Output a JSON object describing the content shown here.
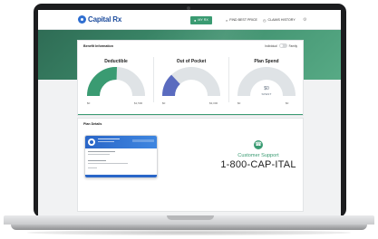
{
  "app": {
    "brand": "Capital Rx"
  },
  "nav": {
    "my_rx": "MY RX",
    "find_best_price": "FIND BEST PRICE",
    "claims_history": "CLAIMS HISTORY"
  },
  "benefits": {
    "title": "Benefit Information",
    "toggle_left": "Individual",
    "toggle_right": "Family",
    "metrics": [
      {
        "title": "Deductible",
        "value": "$767",
        "spent_label": "SPENT",
        "min": "$0",
        "max": "$1,500",
        "fill": 0.51,
        "color": "#3a9b72"
      },
      {
        "title": "Out of Pocket",
        "value": "$767",
        "spent_label": "SPENT",
        "min": "$0",
        "max": "$3,000",
        "fill": 0.26,
        "color": "#5a6bbf"
      },
      {
        "title": "Plan Spend",
        "value": "$0",
        "spent_label": "SPENT",
        "min": "$0",
        "max": "$0",
        "fill": 0,
        "color": "#c9cdd3"
      }
    ]
  },
  "plan": {
    "title": "Plan Details",
    "support_label": "Customer Support",
    "support_phone": "1-800-CAP-ITAL"
  },
  "colors": {
    "accent": "#3a9b72",
    "brand": "#1f4e9e"
  }
}
